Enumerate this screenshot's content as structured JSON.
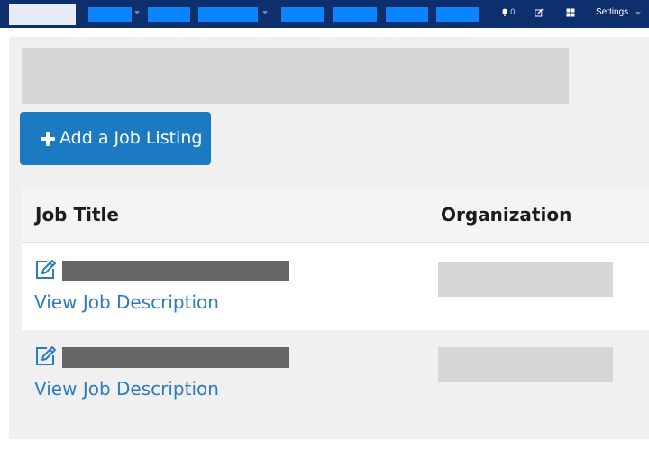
{
  "topbar": {
    "notifications_count": "0",
    "settings_label": "Settings",
    "nav_items": [
      "nav-1",
      "nav-2",
      "nav-3",
      "nav-4",
      "nav-5",
      "nav-6",
      "nav-7"
    ]
  },
  "main": {
    "add_button_label": "Add a Job Listing",
    "table": {
      "columns": [
        "Job Title",
        "Organization"
      ],
      "rows": [
        {
          "link_label": "View Job Description"
        },
        {
          "link_label": "View Job Description"
        }
      ]
    }
  },
  "colors": {
    "topbar": "#0d2f6e",
    "nav_highlight": "#0a84ff",
    "button": "#1b7ac2",
    "link": "#2f7bbf",
    "placeholder": "#d6d6d6",
    "redaction": "#666666"
  },
  "icons": [
    "bell-icon",
    "edit-icon",
    "grid-icon",
    "plus-icon",
    "pencil-square-icon"
  ]
}
